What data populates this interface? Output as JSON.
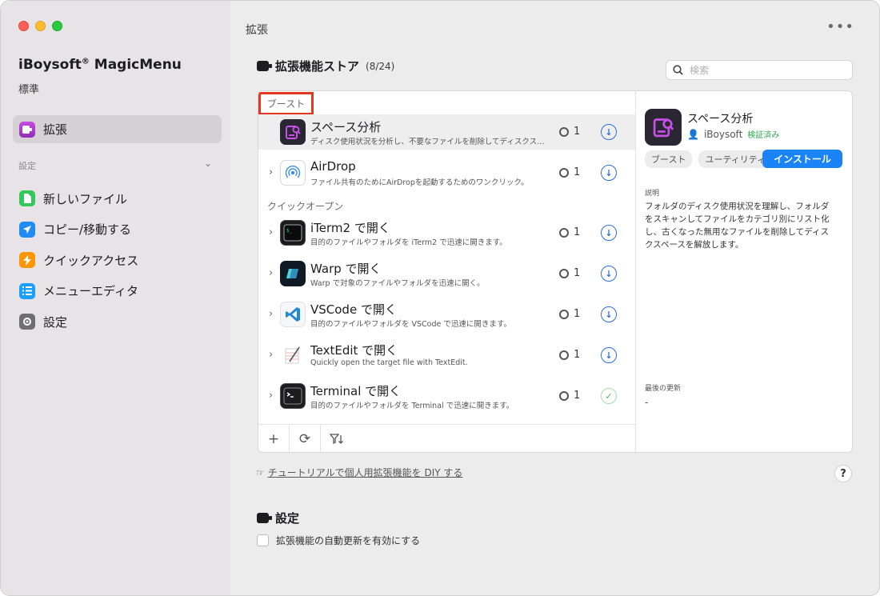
{
  "sidebar": {
    "app_name": "iBoysoft",
    "app_name_suffix": "MagicMenu",
    "registered_mark": "®",
    "edition": "標準",
    "active_item": "拡張",
    "section_label": "設定",
    "items": [
      {
        "label": "新しいファイル",
        "icon": "new-file-icon"
      },
      {
        "label": "コピー/移動する",
        "icon": "send-icon"
      },
      {
        "label": "クイックアクセス",
        "icon": "bolt-icon"
      },
      {
        "label": "メニューエディタ",
        "icon": "list-icon"
      },
      {
        "label": "設定",
        "icon": "gear-icon"
      }
    ]
  },
  "main": {
    "title": "拡張",
    "store_title": "拡張機能ストア",
    "store_count": "(8/24)",
    "search_placeholder": "検索",
    "groups": [
      {
        "label": "ブースト"
      },
      {
        "label": "クイックオープン"
      }
    ],
    "extensions": [
      {
        "name": "スペース分析",
        "desc": "ディスク使用状況を分析し、不要なファイルを削除してディスクス…",
        "version": "1",
        "status": "download"
      },
      {
        "name": "AirDrop",
        "desc": "ファイル共有のためにAirDropを起動するためのワンクリック。",
        "version": "1",
        "status": "download"
      },
      {
        "name": "iTerm2 で開く",
        "desc": "目的のファイルやフォルダを iTerm2 で迅速に開きます。",
        "version": "1",
        "status": "download"
      },
      {
        "name": "Warp で開く",
        "desc": "Warp で対象のファイルやフォルダを迅速に開く。",
        "version": "1",
        "status": "download"
      },
      {
        "name": "VSCode で開く",
        "desc": "目的のファイルやフォルダを VSCode で迅速に開きます。",
        "version": "1",
        "status": "download"
      },
      {
        "name": "TextEdit で開く",
        "desc": "Quickly open the target file with TextEdit.",
        "version": "1",
        "status": "download"
      },
      {
        "name": "Terminal で開く",
        "desc": "目的のファイルやフォルダを Terminal で迅速に開きます。",
        "version": "1",
        "status": "installed"
      }
    ],
    "detail": {
      "name": "スペース分析",
      "author": "iBoysoft",
      "verified": "検証済み",
      "tags": [
        "ブースト",
        "ユーティリティ"
      ],
      "install_label": "インストール",
      "desc_label": "説明",
      "description": "フォルダのディスク使用状況を理解し、フォルダをスキャンしてファイルをカテゴリ別にリスト化し、古くなった無用なファイルを削除してディスクスペースを解放します。",
      "updated_label": "最後の更新",
      "updated_value": "-"
    },
    "tutorial_link": "チュートリアルで個人用拡張機能を DIY する",
    "help_label": "?",
    "settings_title": "設定",
    "auto_update_label": "拡張機能の自動更新を有効にする"
  },
  "colors": {
    "accent": "#1a83f7",
    "highlight_box": "#e5371f",
    "verified": "#2fa84f"
  }
}
